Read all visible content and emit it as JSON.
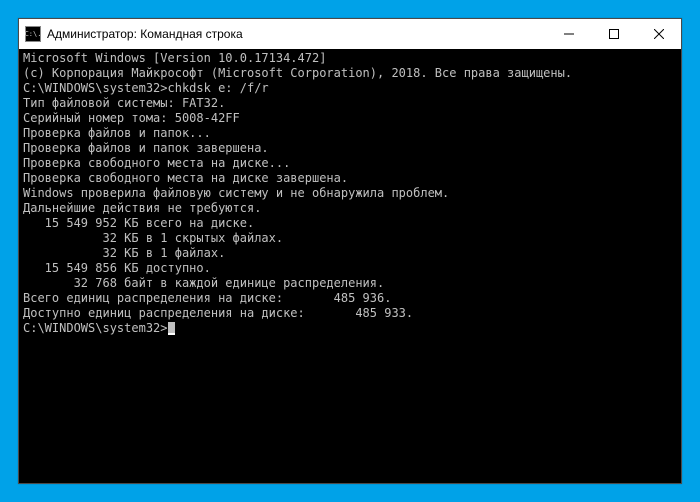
{
  "window": {
    "icon_text": "C:\\.",
    "title": "Администратор: Командная строка"
  },
  "terminal": {
    "line01": "Microsoft Windows [Version 10.0.17134.472]",
    "line02": "(c) Корпорация Майкрософт (Microsoft Corporation), 2018. Все права защищены.",
    "blank1": "",
    "prompt1_path": "C:\\WINDOWS\\system32>",
    "prompt1_cmd": "chkdsk e: /f/r",
    "line03": "Тип файловой системы: FAT32.",
    "line04": "Серийный номер тома: 5008-42FF",
    "line05": "Проверка файлов и папок...",
    "line06": "Проверка файлов и папок завершена.",
    "line07": "Проверка свободного места на диске...",
    "line08": "Проверка свободного места на диске завершена.",
    "blank2": "",
    "line09": "Windows проверила файловую систему и не обнаружила проблем.",
    "line10": "Дальнейшие действия не требуются.",
    "line11": "   15 549 952 КБ всего на диске.",
    "line12": "           32 КБ в 1 скрытых файлах.",
    "line13": "           32 КБ в 1 файлах.",
    "line14": "   15 549 856 КБ доступно.",
    "blank3": "",
    "line15": "       32 768 байт в каждой единице распределения.",
    "line16": "Всего единиц распределения на диске:       485 936.",
    "line17": "Доступно единиц распределения на диске:       485 933.",
    "blank4": "",
    "prompt2_path": "C:\\WINDOWS\\system32>"
  }
}
